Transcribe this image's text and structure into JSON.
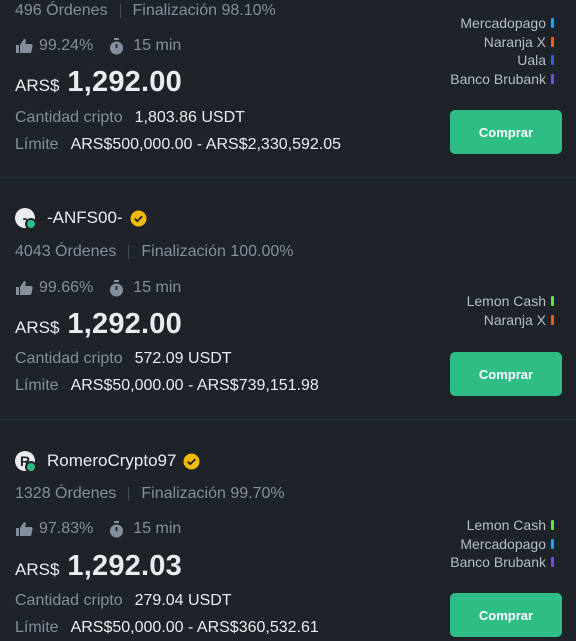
{
  "colors": {
    "background": "#1e2329",
    "buy_button": "#2ebd85",
    "verified_badge": "#f0b90b",
    "online_dot": "#2ebd85",
    "pay_mercadopago": "#1ea2f1",
    "pay_naranja": "#f25c19",
    "pay_uala": "#3c5cdb",
    "pay_brubank": "#6f51d6",
    "pay_lemon": "#5fe639"
  },
  "ads": [
    {
      "orders": "496 Órdenes",
      "completion": "Finalización 98.10%",
      "rating": "99.24%",
      "time": "15 min",
      "currency": "ARS$",
      "price": "1,292.00",
      "qty_label": "Cantidad cripto",
      "qty_value": "1,803.86 USDT",
      "limit_label": "Límite",
      "limit_value": "ARS$500,000.00 - ARS$2,330,592.05",
      "payments": [
        "Mercadopago",
        "Naranja X",
        "Uala",
        "Banco Brubank"
      ],
      "buy_label": "Comprar"
    },
    {
      "avatar": "-",
      "name": "-ANFS00-",
      "orders": "4043 Órdenes",
      "completion": "Finalización 100.00%",
      "rating": "99.66%",
      "time": "15 min",
      "currency": "ARS$",
      "price": "1,292.00",
      "qty_label": "Cantidad cripto",
      "qty_value": "572.09 USDT",
      "limit_label": "Límite",
      "limit_value": "ARS$50,000.00 - ARS$739,151.98",
      "payments": [
        "Lemon Cash",
        "Naranja X"
      ],
      "buy_label": "Comprar"
    },
    {
      "avatar": "R",
      "name": "RomeroCrypto97",
      "orders": "1328 Órdenes",
      "completion": "Finalización 99.70%",
      "rating": "97.83%",
      "time": "15 min",
      "currency": "ARS$",
      "price": "1,292.03",
      "qty_label": "Cantidad cripto",
      "qty_value": "279.04 USDT",
      "limit_label": "Límite",
      "limit_value": "ARS$50,000.00 - ARS$360,532.61",
      "payments": [
        "Lemon Cash",
        "Mercadopago",
        "Banco Brubank"
      ],
      "buy_label": "Comprar"
    }
  ]
}
